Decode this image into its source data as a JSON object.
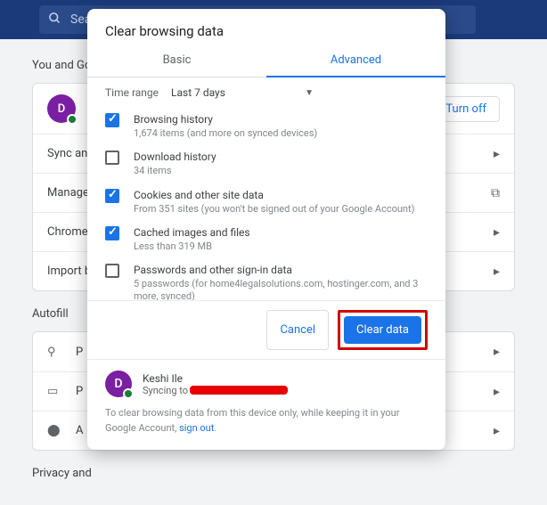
{
  "background": {
    "search_placeholder": "Sea",
    "section_you": "You and Go",
    "avatar_letter": "D",
    "turn_off": "Turn off",
    "rows": {
      "sync": "Sync and",
      "manage": "Manage",
      "chrome": "Chrome",
      "import": "Import b"
    },
    "section_autofill": "Autofill",
    "autofill_rows": {
      "p1": "P",
      "p2": "P",
      "a": "A"
    },
    "section_privacy": "Privacy and"
  },
  "modal": {
    "title": "Clear browsing data",
    "tabs": {
      "basic": "Basic",
      "advanced": "Advanced"
    },
    "time_range_label": "Time range",
    "time_range_value": "Last 7 days",
    "items": [
      {
        "checked": true,
        "title": "Browsing history",
        "sub": "1,674 items (and more on synced devices)"
      },
      {
        "checked": false,
        "title": "Download history",
        "sub": "34 items"
      },
      {
        "checked": true,
        "title": "Cookies and other site data",
        "sub": "From 351 sites (you won't be signed out of your Google Account)"
      },
      {
        "checked": true,
        "title": "Cached images and files",
        "sub": "Less than 319 MB"
      },
      {
        "checked": false,
        "title": "Passwords and other sign-in data",
        "sub": "5 passwords (for home4legalsolutions.com, hostinger.com, and 3 more, synced)"
      }
    ],
    "cancel": "Cancel",
    "clear": "Clear data",
    "footer_user": {
      "avatar": "D",
      "name": "Keshi Ile",
      "sync": "Syncing to"
    },
    "footer_note_pre": "To clear browsing data from this device only, while keeping it in your Google Account, ",
    "footer_note_link": "sign out",
    "footer_note_post": "."
  }
}
